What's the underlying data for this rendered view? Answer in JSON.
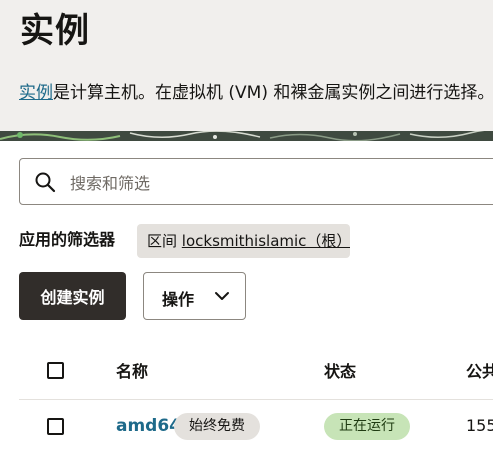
{
  "header": {
    "title": "实例",
    "description_link": "实例",
    "description_text": "是计算主机。在虚拟机 (VM) 和裸金属实例之间进行选择。"
  },
  "search": {
    "placeholder": "搜索和筛选",
    "icon": "search-icon"
  },
  "filters": {
    "label": "应用的筛选器",
    "chips": [
      {
        "prefix": "区间",
        "value": "locksmithislamic（根）"
      }
    ]
  },
  "toolbar": {
    "create_label": "创建实例",
    "actions_label": "操作",
    "actions_icon": "chevron-down-icon"
  },
  "table": {
    "columns": [
      "名称",
      "状态",
      "公共"
    ],
    "rows": [
      {
        "name": "amd64",
        "badge": "始终免费",
        "status": "正在运行",
        "ip": "155"
      }
    ]
  },
  "colors": {
    "link": "#1e6a8a",
    "primary_button": "#312d2a",
    "running_badge": "#c7e4b7",
    "header_bg": "#f1efed"
  }
}
